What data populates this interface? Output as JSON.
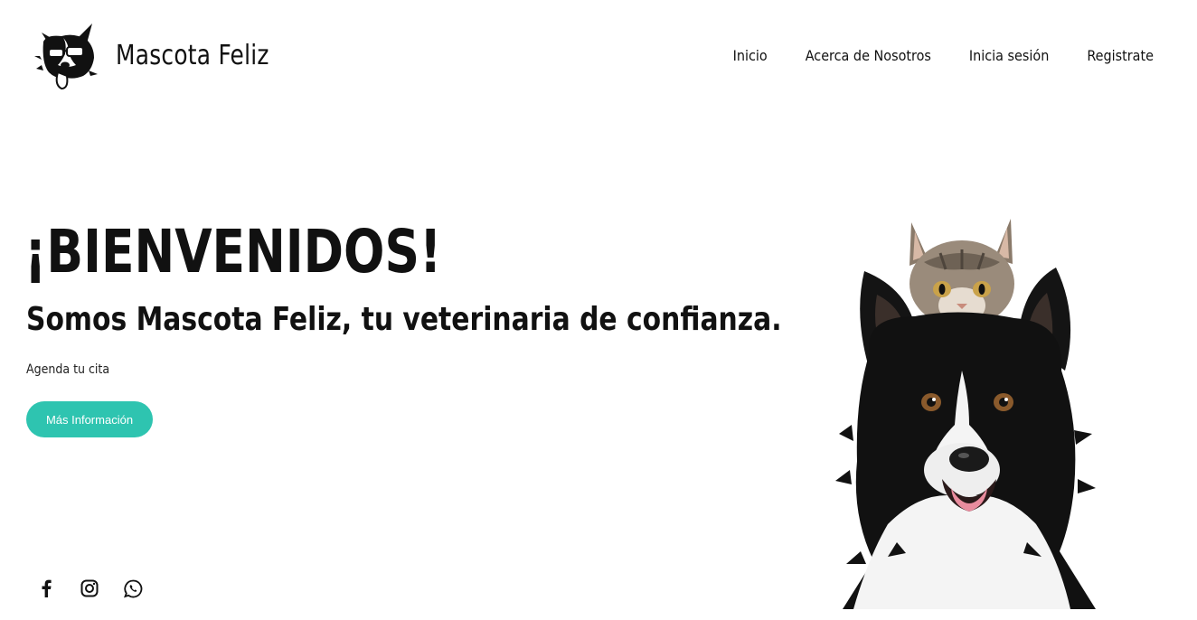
{
  "brand": {
    "name": "Mascota Feliz",
    "logo_icon": "dog-with-sunglasses-icon"
  },
  "nav": {
    "items": [
      {
        "label": "Inicio"
      },
      {
        "label": "Acerca de Nosotros"
      },
      {
        "label": "Inicia sesión"
      },
      {
        "label": "Registrate"
      }
    ]
  },
  "hero": {
    "title": "¡BIENVENIDOS!",
    "subtitle": "Somos Mascota Feliz, tu veterinaria de confianza.",
    "text": "Agenda tu cita",
    "cta_label": "Más Información",
    "image": "cat-on-dog-photo"
  },
  "social": {
    "icons": [
      "facebook-icon",
      "instagram-icon",
      "whatsapp-icon"
    ]
  },
  "colors": {
    "accent": "#2ec4b0",
    "text": "#111111",
    "background": "#ffffff"
  }
}
